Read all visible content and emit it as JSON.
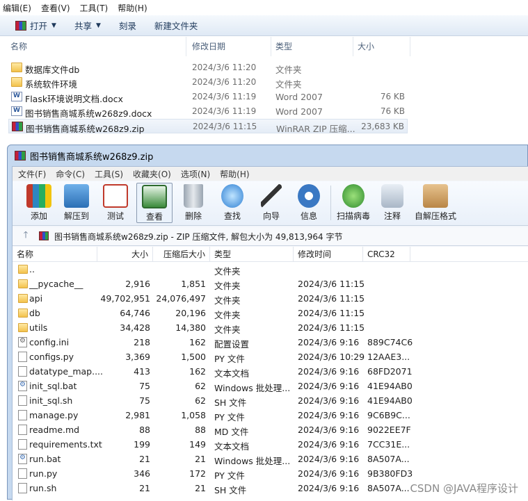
{
  "explorer": {
    "menu": [
      "编辑(E)",
      "查看(V)",
      "工具(T)",
      "帮助(H)"
    ],
    "commands": {
      "open": "打开",
      "share": "共享",
      "burn": "刻录",
      "new_folder": "新建文件夹"
    },
    "columns": {
      "name": "名称",
      "modified": "修改日期",
      "type": "类型",
      "size": "大小"
    },
    "rows": [
      {
        "name": "数据库文件db",
        "date": "2024/3/6 11:20",
        "type": "文件夹",
        "size": "",
        "icon": "folder-icon"
      },
      {
        "name": "系统软件环境",
        "date": "2024/3/6 11:20",
        "type": "文件夹",
        "size": "",
        "icon": "folder-icon"
      },
      {
        "name": "Flask环境说明文档.docx",
        "date": "2024/3/6 11:19",
        "type": "Word 2007",
        "size": "76 KB",
        "icon": "word-doc-icon"
      },
      {
        "name": "图书销售商城系统w268z9.docx",
        "date": "2024/3/6 11:19",
        "type": "Word 2007",
        "size": "76 KB",
        "icon": "word-doc-icon"
      },
      {
        "name": "图书销售商城系统w268z9.zip",
        "date": "2024/3/6 11:15",
        "type": "WinRAR ZIP 压缩...",
        "size": "23,683 KB",
        "icon": "winrar-archive-icon"
      }
    ]
  },
  "winrar": {
    "title": "图书销售商城系统w268z9.zip",
    "menu": [
      "文件(F)",
      "命令(C)",
      "工具(S)",
      "收藏夹(O)",
      "选项(N)",
      "帮助(H)"
    ],
    "toolbar": [
      "添加",
      "解压到",
      "测试",
      "查看",
      "删除",
      "查找",
      "向导",
      "信息",
      "扫描病毒",
      "注释",
      "自解压格式"
    ],
    "address": "图书销售商城系统w268z9.zip - ZIP 压缩文件, 解包大小为 49,813,964 字节",
    "columns": {
      "name": "名称",
      "size": "大小",
      "packed": "压缩后大小",
      "type": "类型",
      "modified": "修改时间",
      "crc": "CRC32"
    },
    "rows": [
      {
        "name": "..",
        "size": "",
        "packed": "",
        "type": "文件夹",
        "date": "",
        "crc": "",
        "icon": "folder-icon"
      },
      {
        "name": "__pycache__",
        "size": "2,916",
        "packed": "1,851",
        "type": "文件夹",
        "date": "2024/3/6 11:15",
        "crc": "",
        "icon": "folder-icon"
      },
      {
        "name": "api",
        "size": "49,702,951",
        "packed": "24,076,497",
        "type": "文件夹",
        "date": "2024/3/6 11:15",
        "crc": "",
        "icon": "folder-icon"
      },
      {
        "name": "db",
        "size": "64,746",
        "packed": "20,196",
        "type": "文件夹",
        "date": "2024/3/6 11:15",
        "crc": "",
        "icon": "folder-icon"
      },
      {
        "name": "utils",
        "size": "34,428",
        "packed": "14,380",
        "type": "文件夹",
        "date": "2024/3/6 11:15",
        "crc": "",
        "icon": "folder-icon"
      },
      {
        "name": "config.ini",
        "size": "218",
        "packed": "162",
        "type": "配置设置",
        "date": "2024/3/6 9:16",
        "crc": "889C74C6",
        "icon": "config-file-icon"
      },
      {
        "name": "configs.py",
        "size": "3,369",
        "packed": "1,500",
        "type": "PY 文件",
        "date": "2024/3/6 10:29",
        "crc": "12AAE3...",
        "icon": "file-icon"
      },
      {
        "name": "datatype_map....",
        "size": "413",
        "packed": "162",
        "type": "文本文档",
        "date": "2024/3/6 9:16",
        "crc": "68FD2071",
        "icon": "file-icon"
      },
      {
        "name": "init_sql.bat",
        "size": "75",
        "packed": "62",
        "type": "Windows 批处理...",
        "date": "2024/3/6 9:16",
        "crc": "41E94AB0",
        "icon": "batch-file-icon"
      },
      {
        "name": "init_sql.sh",
        "size": "75",
        "packed": "62",
        "type": "SH 文件",
        "date": "2024/3/6 9:16",
        "crc": "41E94AB0",
        "icon": "file-icon"
      },
      {
        "name": "manage.py",
        "size": "2,981",
        "packed": "1,058",
        "type": "PY 文件",
        "date": "2024/3/6 9:16",
        "crc": "9C6B9C...",
        "icon": "file-icon"
      },
      {
        "name": "readme.md",
        "size": "88",
        "packed": "88",
        "type": "MD 文件",
        "date": "2024/3/6 9:16",
        "crc": "9022EE7F",
        "icon": "file-icon"
      },
      {
        "name": "requirements.txt",
        "size": "199",
        "packed": "149",
        "type": "文本文档",
        "date": "2024/3/6 9:16",
        "crc": "7CC31E...",
        "icon": "file-icon"
      },
      {
        "name": "run.bat",
        "size": "21",
        "packed": "21",
        "type": "Windows 批处理...",
        "date": "2024/3/6 9:16",
        "crc": "8A507A...",
        "icon": "batch-file-icon"
      },
      {
        "name": "run.py",
        "size": "346",
        "packed": "172",
        "type": "PY 文件",
        "date": "2024/3/6 9:16",
        "crc": "9B380FD3",
        "icon": "file-icon"
      },
      {
        "name": "run.sh",
        "size": "21",
        "packed": "21",
        "type": "SH 文件",
        "date": "2024/3/6 9:16",
        "crc": "8A507A...",
        "icon": "file-icon"
      }
    ]
  },
  "watermark": "CSDN @JAVA程序设计"
}
